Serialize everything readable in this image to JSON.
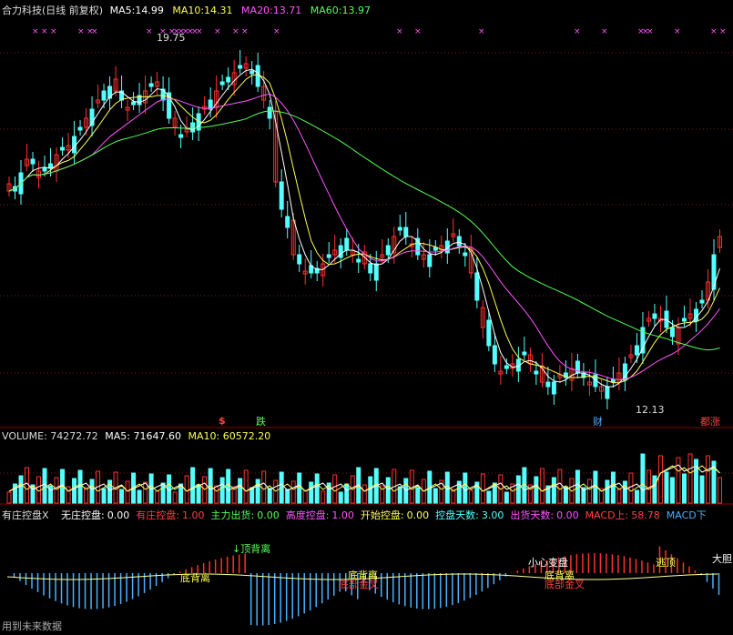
{
  "header": {
    "stock_name": "合力科技",
    "period": "(日线 前复权)",
    "ma5": {
      "label": "MA5:",
      "value": "14.99",
      "color": "#ffffff"
    },
    "ma10": {
      "label": "MA10:",
      "value": "14.31",
      "color": "#ffff55"
    },
    "ma20": {
      "label": "MA20:",
      "value": "13.71",
      "color": "#ff55ff"
    },
    "ma60": {
      "label": "MA60:",
      "value": "13.97",
      "color": "#55ff55"
    }
  },
  "price_chart": {
    "high_label": "19.75",
    "low_label": "12.13",
    "markers": [
      {
        "text": "$",
        "color": "#ff4040"
      },
      {
        "text": "跌",
        "color": "#55ff55"
      },
      {
        "text": "财",
        "color": "#4ab0ff"
      },
      {
        "text": "都涨",
        "color": "#ff4040"
      }
    ]
  },
  "volume": {
    "label": "VOLUME:",
    "value": "74272.72",
    "ma5_label": "MA5:",
    "ma5_value": "71647.60",
    "ma10_label": "MA10:",
    "ma10_value": "60572.20"
  },
  "indicator": {
    "title": "有庄控盘X",
    "fields": [
      {
        "label": "无庄控盘:",
        "value": "0.00",
        "color": "#ffffff"
      },
      {
        "label": "有庄控盘:",
        "value": "1.00",
        "color": "#ff4040"
      },
      {
        "label": "主力出货:",
        "value": "0.00",
        "color": "#55ff55"
      },
      {
        "label": "高度控盘:",
        "value": "1.00",
        "color": "#ff55ff"
      },
      {
        "label": "开始控盘:",
        "value": "0.00",
        "color": "#ffff55"
      },
      {
        "label": "控盘天数:",
        "value": "3.00",
        "color": "#55ffff"
      },
      {
        "label": "出货天数:",
        "value": "0.00",
        "color": "#ff55ff"
      },
      {
        "label": "MACD上:",
        "value": "58.78",
        "color": "#ff4040"
      },
      {
        "label": "MACD下",
        "value": "",
        "color": "#4ab0ff"
      }
    ],
    "annotations": [
      {
        "text": "顶背离",
        "color": "#55ff55"
      },
      {
        "text": "底背离",
        "color": "#ffff55"
      },
      {
        "text": "底背离",
        "color": "#ffff55"
      },
      {
        "text": "底部金叉",
        "color": "#ff4040"
      },
      {
        "text": "小心变盘",
        "color": "#ffffff"
      },
      {
        "text": "底背离",
        "color": "#ffff55"
      },
      {
        "text": "底部金叉",
        "color": "#ff4040"
      },
      {
        "text": "逃顶",
        "color": "#ffff55"
      },
      {
        "text": "大胆",
        "color": "#ffffff"
      }
    ]
  },
  "footer": {
    "future_data_label": "用到未来数据"
  }
}
